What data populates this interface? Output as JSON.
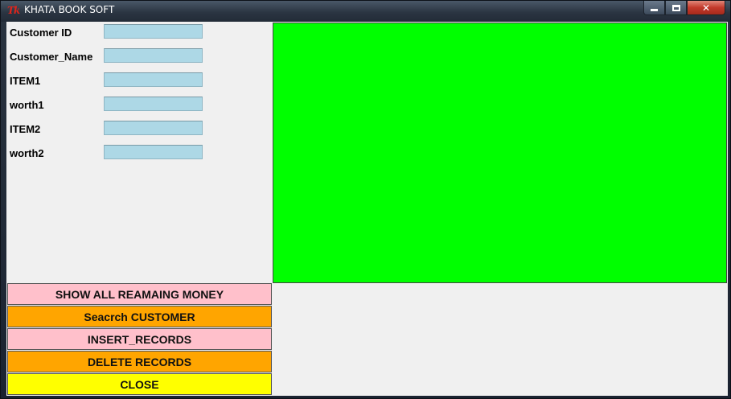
{
  "window": {
    "title": "KHATA BOOK SOFT",
    "icon_text": "Tk",
    "close_glyph": "✕"
  },
  "form": {
    "fields": [
      {
        "label": "Customer ID",
        "value": ""
      },
      {
        "label": "Customer_Name",
        "value": ""
      },
      {
        "label": "ITEM1",
        "value": ""
      },
      {
        "label": "worth1",
        "value": ""
      },
      {
        "label": "ITEM2",
        "value": ""
      },
      {
        "label": "worth2",
        "value": ""
      }
    ]
  },
  "buttons": {
    "show_all": "SHOW ALL REAMAING MONEY",
    "search": "Seacrch CUSTOMER",
    "insert": "INSERT_RECORDS",
    "delete": "DELETE RECORDS",
    "close": "CLOSE"
  },
  "colors": {
    "input_bg": "#add8e6",
    "panel_green": "#00ff00",
    "button_pink": "#ffc0cb",
    "button_orange": "#ffa500",
    "button_yellow": "#ffff00"
  }
}
